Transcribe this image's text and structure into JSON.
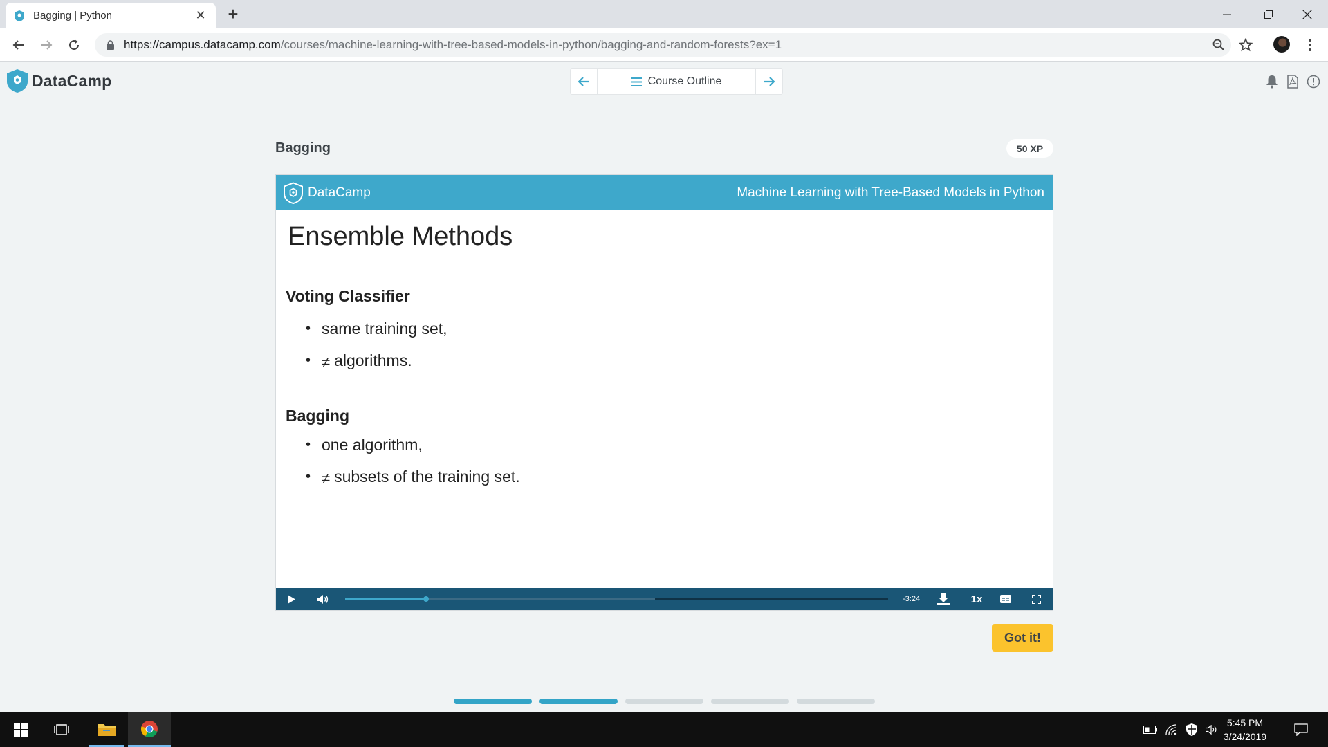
{
  "browser": {
    "tab_title": "Bagging | Python",
    "url_host": "https://campus.datacamp.com",
    "url_path": "/courses/machine-learning-with-tree-based-models-in-python/bagging-and-random-forests?ex=1",
    "new_tab_label": "+",
    "close_tab_label": "✕"
  },
  "header": {
    "brand": "DataCamp",
    "course_outline": "Course Outline"
  },
  "exercise": {
    "title": "Bagging",
    "xp": "50 XP",
    "got_it": "Got it!"
  },
  "slide": {
    "brand": "DataCamp",
    "course_name": "Machine Learning with Tree-Based Models in Python",
    "heading": "Ensemble Methods",
    "sections": [
      {
        "title": "Voting Classifier",
        "bullets": [
          {
            "prefix": "",
            "text": "same training set,"
          },
          {
            "prefix": "≠",
            "text": "algorithms."
          }
        ]
      },
      {
        "title": "Bagging",
        "bullets": [
          {
            "prefix": "",
            "text": "one algorithm,"
          },
          {
            "prefix": "≠",
            "text": "subsets of the training set."
          }
        ]
      }
    ]
  },
  "player": {
    "time_remaining": "-3:24",
    "speed": "1x",
    "played_fraction": 0.149,
    "buffered_fraction": 0.571
  },
  "progress": {
    "steps_total": 5,
    "steps_completed": 2
  },
  "taskbar": {
    "time": "5:45 PM",
    "date": "3/24/2019"
  },
  "colors": {
    "brand_blue": "#3ea8cb",
    "player_bg": "#1a5676",
    "cta_yellow": "#fbc32d",
    "step_done": "#33a4c7",
    "step_todo": "#d3dadd"
  }
}
